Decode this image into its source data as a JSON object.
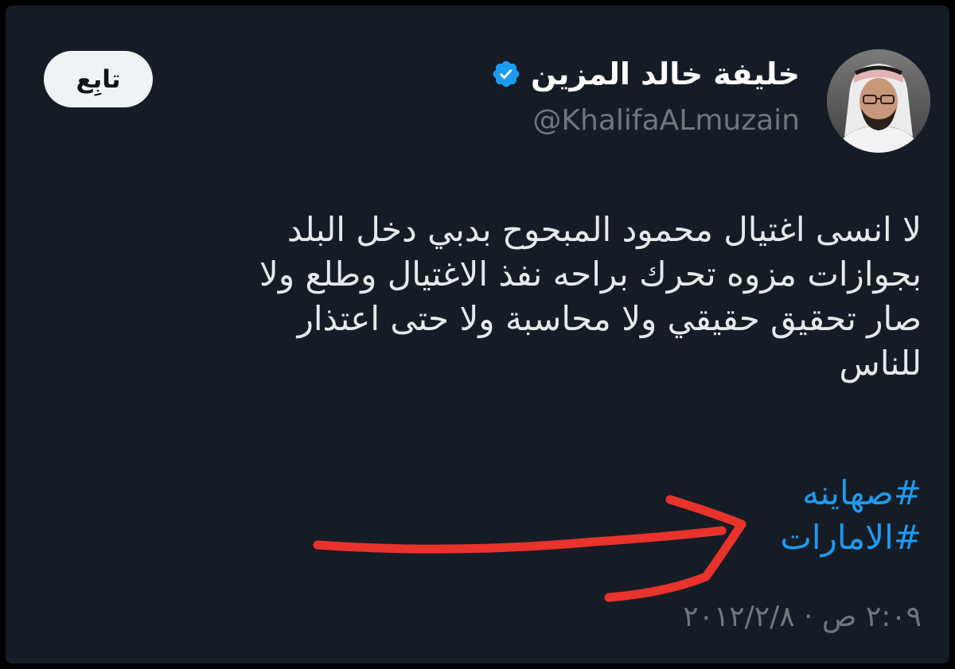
{
  "author": {
    "display_name": "خليفة خالد المزين",
    "handle": "@KhalifaALmuzain",
    "verified_icon": "verified-badge-icon",
    "avatar_icon": "profile-avatar"
  },
  "follow_button": {
    "label": "تابِع"
  },
  "tweet": {
    "lines": [
      "لا انسى اغتيال محمود المبحوح بدبي دخل البلد",
      "بجوازات مزوه تحرك براحه نفذ الاغتيال وطلع ولا",
      "صار تحقيق حقيقي ولا محاسبة ولا حتى اعتذار",
      "للناس"
    ],
    "hashtags": [
      "#صهاينه",
      "#الامارات"
    ],
    "timestamp": "٢:٠٩ ص · ٢٠١٢/٢/٨"
  },
  "annotation": {
    "type": "red-arrow-pointing-to-hashtag",
    "color": "#e8322b"
  },
  "colors": {
    "background": "#161c26",
    "text": "#e7e9ea",
    "muted": "#71767b",
    "link": "#1d9bf0",
    "verified": "#1d9bf0"
  }
}
